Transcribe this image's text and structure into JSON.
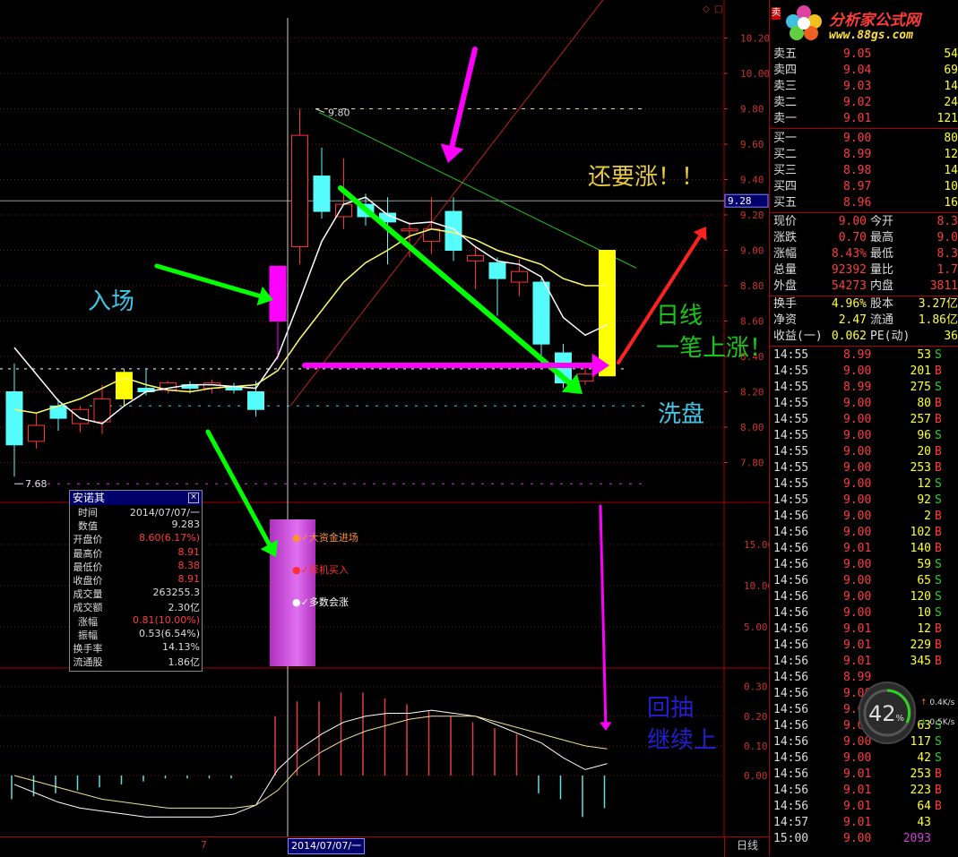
{
  "chart_data": {
    "type": "candlestick",
    "price_axis": {
      "ticks": [
        "10.20",
        "10.00",
        "9.80",
        "9.60",
        "9.40",
        "9.20",
        "9.00",
        "8.80",
        "8.60",
        "8.40",
        "8.20",
        "8.00",
        "7.80"
      ],
      "current_marker": "9.28"
    },
    "high_label": "9.80",
    "low_label": "7.68",
    "volume_axis": {
      "ticks": [
        "15.00",
        "10.00",
        "5.00"
      ]
    },
    "macd_axis": {
      "ticks": [
        "0.30",
        "0.20",
        "0.10",
        "0.00"
      ]
    },
    "candles": [
      {
        "o": 8.2,
        "h": 8.36,
        "l": 7.72,
        "c": 7.9,
        "up": false
      },
      {
        "o": 7.92,
        "h": 8.08,
        "l": 7.88,
        "c": 8.01,
        "up": true
      },
      {
        "o": 8.12,
        "h": 8.16,
        "l": 7.98,
        "c": 8.05,
        "up": false
      },
      {
        "o": 8.02,
        "h": 8.12,
        "l": 7.97,
        "c": 8.1,
        "up": true
      },
      {
        "o": 8.03,
        "h": 8.24,
        "l": 7.96,
        "c": 8.16,
        "up": true
      },
      {
        "o": 8.16,
        "h": 8.33,
        "l": 8.12,
        "c": 8.31,
        "up": true,
        "highlight": "yellow"
      },
      {
        "o": 8.2,
        "h": 8.33,
        "l": 8.18,
        "c": 8.22,
        "up": false
      },
      {
        "o": 8.21,
        "h": 8.26,
        "l": 8.19,
        "c": 8.25,
        "up": true
      },
      {
        "o": 8.22,
        "h": 8.26,
        "l": 8.19,
        "c": 8.24,
        "up": false
      },
      {
        "o": 8.22,
        "h": 8.27,
        "l": 8.19,
        "c": 8.25,
        "up": true
      },
      {
        "o": 8.21,
        "h": 8.25,
        "l": 8.19,
        "c": 8.23,
        "up": false
      },
      {
        "o": 8.2,
        "h": 8.26,
        "l": 8.06,
        "c": 8.1,
        "up": false
      },
      {
        "o": 8.6,
        "h": 8.91,
        "l": 8.38,
        "c": 8.91,
        "up": true,
        "highlight": "magenta"
      },
      {
        "o": 9.02,
        "h": 9.8,
        "l": 8.92,
        "c": 9.65,
        "up": true
      },
      {
        "o": 9.42,
        "h": 9.58,
        "l": 9.18,
        "c": 9.22,
        "up": false
      },
      {
        "o": 9.19,
        "h": 9.52,
        "l": 9.12,
        "c": 9.26,
        "up": true
      },
      {
        "o": 9.26,
        "h": 9.32,
        "l": 9.14,
        "c": 9.19,
        "up": false
      },
      {
        "o": 9.21,
        "h": 9.3,
        "l": 8.92,
        "c": 9.16,
        "up": false
      },
      {
        "o": 9.12,
        "h": 9.16,
        "l": 8.96,
        "c": 9.11,
        "up": true
      },
      {
        "o": 9.05,
        "h": 9.3,
        "l": 8.98,
        "c": 9.12,
        "up": true
      },
      {
        "o": 9.22,
        "h": 9.3,
        "l": 8.94,
        "c": 9.0,
        "up": false
      },
      {
        "o": 8.97,
        "h": 9.02,
        "l": 8.78,
        "c": 8.94,
        "up": true
      },
      {
        "o": 8.93,
        "h": 8.96,
        "l": 8.63,
        "c": 8.84,
        "up": false
      },
      {
        "o": 8.88,
        "h": 8.95,
        "l": 8.74,
        "c": 8.82,
        "up": true
      },
      {
        "o": 8.82,
        "h": 8.84,
        "l": 8.34,
        "c": 8.47,
        "up": false
      },
      {
        "o": 8.42,
        "h": 8.47,
        "l": 8.22,
        "c": 8.25,
        "up": false
      },
      {
        "o": 8.26,
        "h": 8.35,
        "l": 8.24,
        "c": 8.3,
        "up": true
      },
      {
        "o": 8.29,
        "h": 9.0,
        "l": 8.29,
        "c": 9.0,
        "up": true,
        "highlight": "yellow"
      }
    ],
    "ma_white": [
      8.45,
      8.3,
      8.15,
      8.05,
      8.02,
      8.12,
      8.2,
      8.22,
      8.24,
      8.24,
      8.23,
      8.22,
      8.4,
      8.72,
      9.05,
      9.26,
      9.3,
      9.2,
      9.15,
      9.16,
      9.12,
      9.02,
      8.94,
      8.92,
      8.85,
      8.62,
      8.52,
      8.58
    ],
    "ma_yellow": [
      8.1,
      8.08,
      8.12,
      8.16,
      8.22,
      8.28,
      8.24,
      8.21,
      8.2,
      8.22,
      8.23,
      8.24,
      8.32,
      8.5,
      8.66,
      8.82,
      8.93,
      9.0,
      9.08,
      9.12,
      9.1,
      9.06,
      9.0,
      8.96,
      8.92,
      8.84,
      8.8,
      8.8
    ],
    "macd_bars": [
      -0.08,
      -0.07,
      -0.06,
      -0.05,
      -0.04,
      -0.03,
      -0.02,
      -0.01,
      -0.01,
      -0.01,
      -0.01,
      0.0,
      0.2,
      0.25,
      0.25,
      0.28,
      0.28,
      0.26,
      0.24,
      0.22,
      0.2,
      0.18,
      0.16,
      0.14,
      -0.06,
      -0.08,
      -0.14,
      -0.11
    ],
    "macd_line": [
      -0.03,
      -0.06,
      -0.09,
      -0.11,
      -0.12,
      -0.13,
      -0.14,
      -0.14,
      -0.14,
      -0.14,
      -0.13,
      -0.1,
      0.02,
      0.09,
      0.14,
      0.18,
      0.2,
      0.21,
      0.21,
      0.22,
      0.21,
      0.2,
      0.17,
      0.14,
      0.11,
      0.06,
      0.02,
      0.04
    ],
    "macd_signal": [
      0.0,
      -0.02,
      -0.04,
      -0.06,
      -0.08,
      -0.09,
      -0.1,
      -0.11,
      -0.11,
      -0.11,
      -0.11,
      -0.1,
      -0.05,
      0.03,
      0.08,
      0.12,
      0.15,
      0.17,
      0.19,
      0.2,
      0.2,
      0.2,
      0.18,
      0.16,
      0.14,
      0.12,
      0.1,
      0.09
    ]
  },
  "annotations": {
    "enter": "入场",
    "still_rise": "还要涨！！",
    "daily_line_1": "日线",
    "daily_line_2": "一笔上涨！",
    "wash": "洗盘",
    "pullback_1": "回抽",
    "pullback_2": "继续上",
    "signal_big_money": "大资金进场",
    "signal_buy": "择机买入",
    "signal_rise": "多数会涨"
  },
  "logo": {
    "name": "分析家公式网",
    "url": "www.88gs.com"
  },
  "info_box": {
    "title": "安诺其",
    "rows": [
      {
        "k": "时间",
        "v": "2014/07/07/一",
        "color": "#dddddd"
      },
      {
        "k": "数值",
        "v": "9.283",
        "color": "#dddddd"
      },
      {
        "k": "开盘价",
        "v": "8.60(6.17%)",
        "color": "#ff3c3c"
      },
      {
        "k": "最高价",
        "v": "8.91",
        "color": "#ff3c3c"
      },
      {
        "k": "最低价",
        "v": "8.38",
        "color": "#ff3c3c"
      },
      {
        "k": "收盘价",
        "v": "8.91",
        "color": "#ff3c3c"
      },
      {
        "k": "成交量",
        "v": "263255.3",
        "color": "#dddddd"
      },
      {
        "k": "成交额",
        "v": "2.30亿",
        "color": "#dddddd"
      },
      {
        "k": "涨幅",
        "v": "0.81(10.00%)",
        "color": "#ff3c3c"
      },
      {
        "k": "振幅",
        "v": "0.53(6.54%)",
        "color": "#dddddd"
      },
      {
        "k": "换手率",
        "v": "14.13%",
        "color": "#dddddd"
      },
      {
        "k": "流通股",
        "v": "1.86亿",
        "color": "#dddddd"
      }
    ]
  },
  "bottom_bar": {
    "date_tick": "7",
    "cursor_date": "2014/07/07/一",
    "period": "日线"
  },
  "quote_panel": {
    "top_label": "卖",
    "asks": [
      {
        "label": "卖五",
        "price": "9.05",
        "vol": "54"
      },
      {
        "label": "卖四",
        "price": "9.04",
        "vol": "69"
      },
      {
        "label": "卖三",
        "price": "9.03",
        "vol": "14"
      },
      {
        "label": "卖二",
        "price": "9.02",
        "vol": "24"
      },
      {
        "label": "卖一",
        "price": "9.01",
        "vol": "121"
      }
    ],
    "bids": [
      {
        "label": "买一",
        "price": "9.00",
        "vol": "80"
      },
      {
        "label": "买二",
        "price": "8.99",
        "vol": "12"
      },
      {
        "label": "买三",
        "price": "8.98",
        "vol": "14"
      },
      {
        "label": "买四",
        "price": "8.97",
        "vol": "10"
      },
      {
        "label": "买五",
        "price": "8.96",
        "vol": "16"
      }
    ],
    "stats": [
      {
        "k1": "现价",
        "v1": "9.00",
        "k2": "今开",
        "v2": "8.3"
      },
      {
        "k1": "涨跌",
        "v1": "0.70",
        "k2": "最高",
        "v2": "9.0"
      },
      {
        "k1": "涨幅",
        "v1": "8.43%",
        "k2": "最低",
        "v2": "8.3"
      },
      {
        "k1": "总量",
        "v1": "92392",
        "k2": "量比",
        "v2": "1.7"
      },
      {
        "k1": "外盘",
        "v1": "54273",
        "k2": "内盘",
        "v2": "3811"
      }
    ],
    "stats2": [
      {
        "k1": "换手",
        "v1": "4.96%",
        "k2": "股本",
        "v2": "3.27亿"
      },
      {
        "k1": "净资",
        "v1": "2.47",
        "k2": "流通",
        "v2": "1.86亿"
      },
      {
        "k1": "收益(一)",
        "v1": "0.062",
        "k2": "PE(动)",
        "v2": "36"
      }
    ],
    "ticks": [
      {
        "t": "14:55",
        "p": "8.99",
        "v": "53",
        "s": "S"
      },
      {
        "t": "14:55",
        "p": "9.00",
        "v": "201",
        "s": "B"
      },
      {
        "t": "14:55",
        "p": "8.99",
        "v": "275",
        "s": "S"
      },
      {
        "t": "14:55",
        "p": "9.00",
        "v": "80",
        "s": "B"
      },
      {
        "t": "14:55",
        "p": "9.00",
        "v": "257",
        "s": "B"
      },
      {
        "t": "14:55",
        "p": "9.00",
        "v": "96",
        "s": "S"
      },
      {
        "t": "14:55",
        "p": "9.00",
        "v": "20",
        "s": "B"
      },
      {
        "t": "14:55",
        "p": "9.00",
        "v": "253",
        "s": "B"
      },
      {
        "t": "14:55",
        "p": "9.00",
        "v": "12",
        "s": "S"
      },
      {
        "t": "14:55",
        "p": "9.00",
        "v": "92",
        "s": "S"
      },
      {
        "t": "14:56",
        "p": "9.00",
        "v": "2",
        "s": "B"
      },
      {
        "t": "14:56",
        "p": "9.00",
        "v": "102",
        "s": "B"
      },
      {
        "t": "14:56",
        "p": "9.01",
        "v": "140",
        "s": "B"
      },
      {
        "t": "14:56",
        "p": "9.00",
        "v": "59",
        "s": "S"
      },
      {
        "t": "14:56",
        "p": "9.00",
        "v": "65",
        "s": "S"
      },
      {
        "t": "14:56",
        "p": "9.00",
        "v": "120",
        "s": "S"
      },
      {
        "t": "14:56",
        "p": "9.00",
        "v": "10",
        "s": "S"
      },
      {
        "t": "14:56",
        "p": "9.01",
        "v": "12",
        "s": "B"
      },
      {
        "t": "14:56",
        "p": "9.01",
        "v": "229",
        "s": "B"
      },
      {
        "t": "14:56",
        "p": "9.01",
        "v": "345",
        "s": "B"
      },
      {
        "t": "14:56",
        "p": "8.99",
        "v": "",
        "s": ""
      },
      {
        "t": "14:56",
        "p": "9.00",
        "v": "",
        "s": ""
      },
      {
        "t": "14:56",
        "p": "9.00",
        "v": "",
        "s": ""
      },
      {
        "t": "14:56",
        "p": "9.00",
        "v": "63",
        "s": "S"
      },
      {
        "t": "14:56",
        "p": "9.00",
        "v": "117",
        "s": "S"
      },
      {
        "t": "14:56",
        "p": "9.00",
        "v": "42",
        "s": "S"
      },
      {
        "t": "14:56",
        "p": "9.01",
        "v": "253",
        "s": "B"
      },
      {
        "t": "14:56",
        "p": "9.01",
        "v": "223",
        "s": "B"
      },
      {
        "t": "14:56",
        "p": "9.01",
        "v": "64",
        "s": "B"
      },
      {
        "t": "14:57",
        "p": "9.01",
        "v": "43",
        "s": ""
      },
      {
        "t": "15:00",
        "p": "9.00",
        "v": "2093",
        "s": ""
      }
    ]
  },
  "gauge": {
    "percent": "42",
    "unit": "%",
    "up_label": "0.4K/s",
    "down_label": "0.5K/s"
  },
  "colors": {
    "up": "#ff3232",
    "down": "#54fcfc",
    "yellow": "#ffff00",
    "magenta": "#ff00ff",
    "green": "#00ff00",
    "white": "#ffffff",
    "ma_yellow": "#ffff66",
    "axis": "#c83232"
  }
}
